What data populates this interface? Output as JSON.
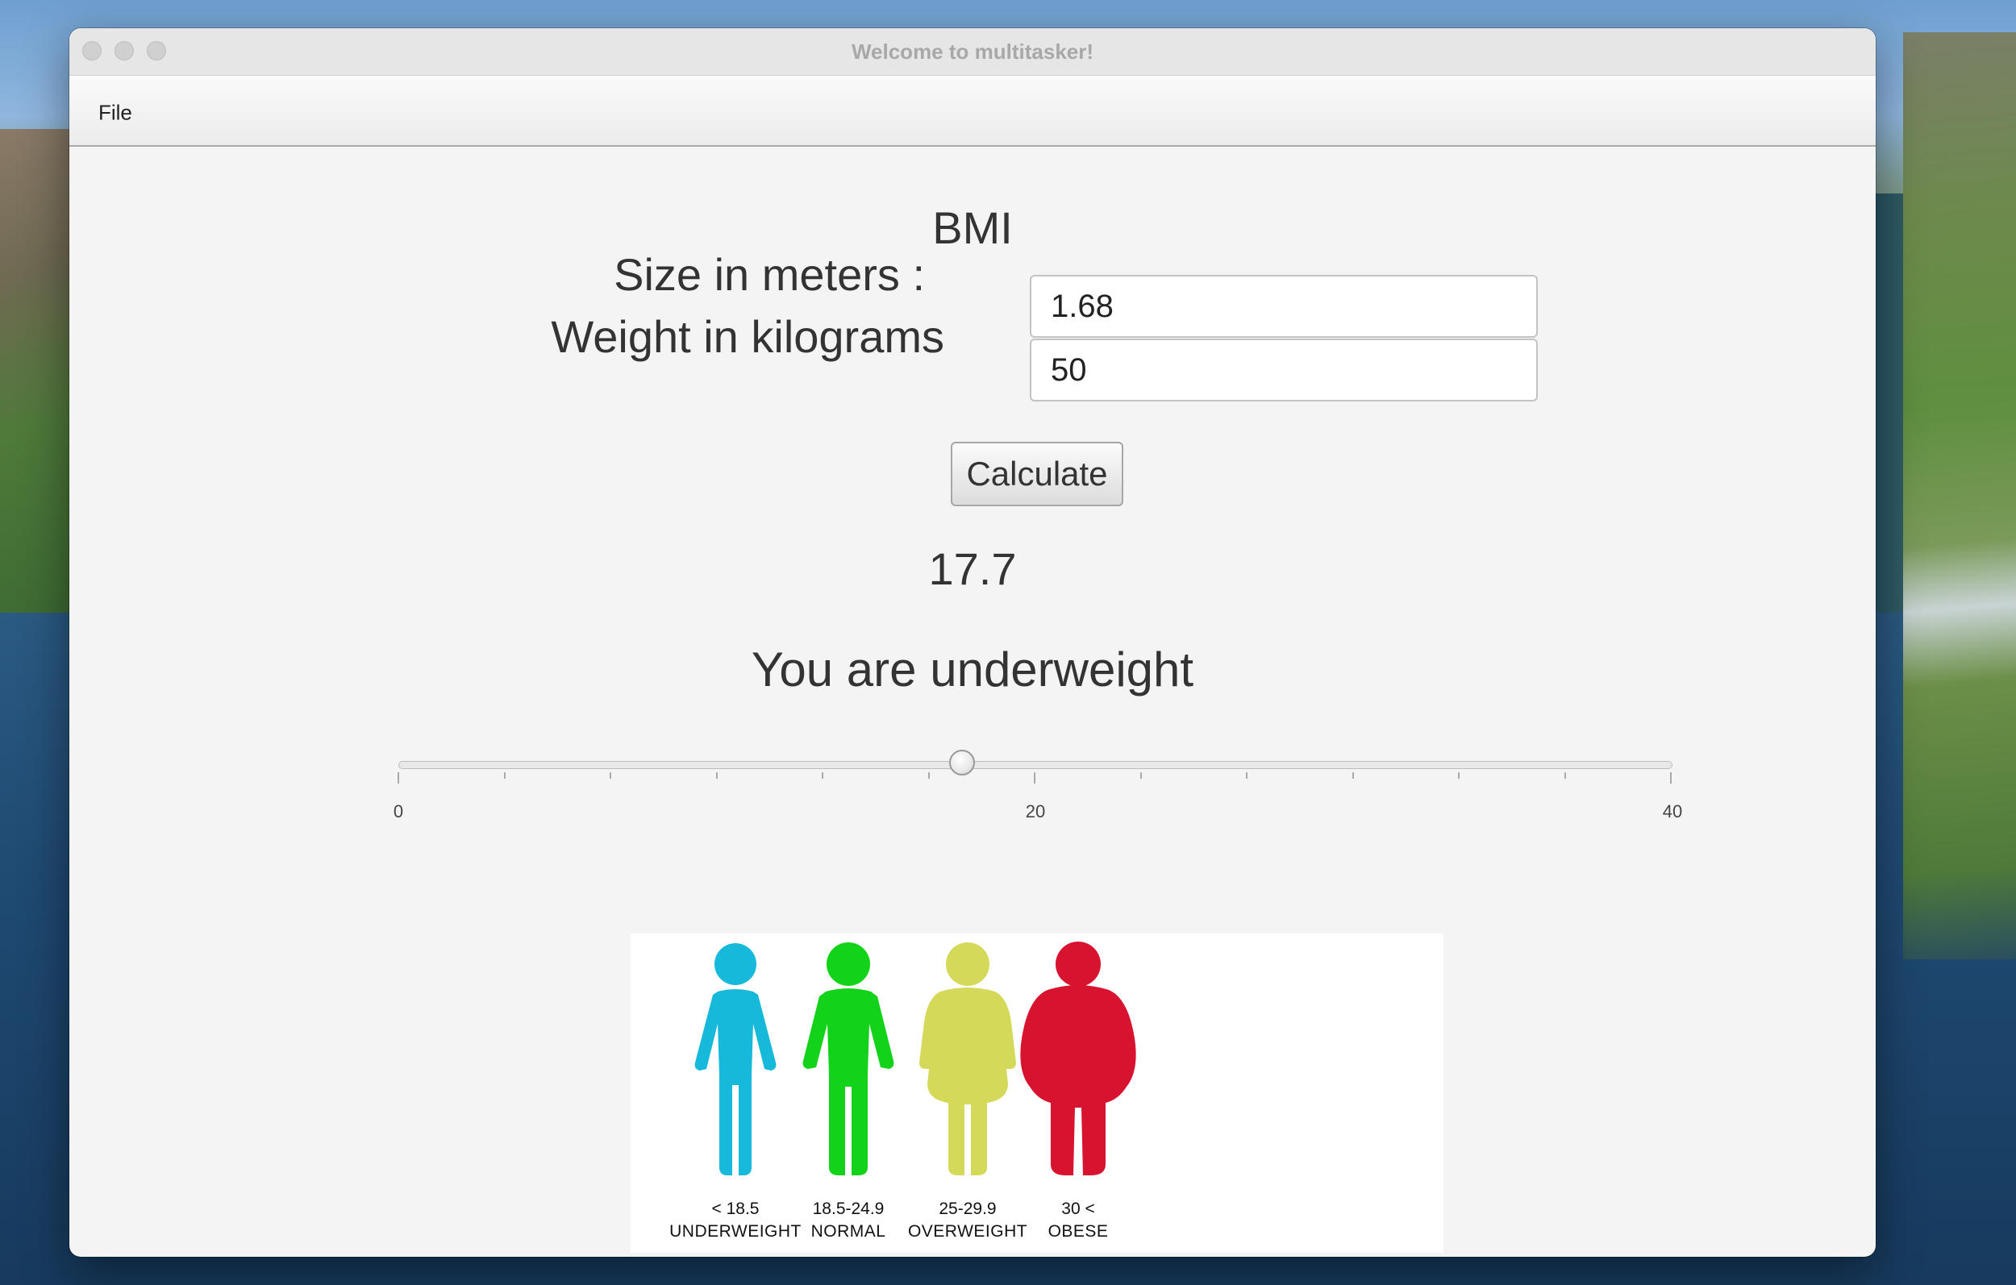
{
  "window": {
    "title": "Welcome to multitasker!"
  },
  "menu": {
    "file_label": "File"
  },
  "form": {
    "title": "BMI",
    "size_label": "Size in meters :",
    "weight_label": "Weight in kilograms",
    "size_value": "1.68",
    "weight_value": "50",
    "calculate_label": "Calculate"
  },
  "result": {
    "value": "17.7",
    "status": "You are underweight"
  },
  "slider": {
    "min": 0,
    "max": 40,
    "value": 17.7,
    "major_step": 20,
    "minor_step": 3.33,
    "labels": [
      "0",
      "20",
      "40"
    ]
  },
  "bmi_chart": {
    "categories": [
      {
        "range": "< 18.5",
        "label": "UNDERWEIGHT",
        "color": "#16b9d9"
      },
      {
        "range": "18.5-24.9",
        "label": "NORMAL",
        "color": "#12d31a"
      },
      {
        "range": "25-29.9",
        "label": "OVERWEIGHT",
        "color": "#d5d95a"
      },
      {
        "range": "30 <",
        "label": "OBESE",
        "color": "#d8132f"
      }
    ]
  }
}
